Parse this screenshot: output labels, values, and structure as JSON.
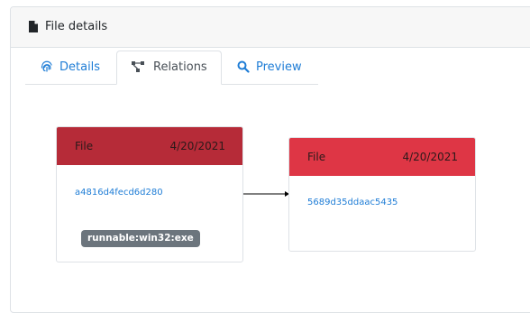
{
  "header": {
    "title": "File details",
    "icon": "file-icon"
  },
  "tabs": [
    {
      "label": "Details",
      "icon": "fingerprint-icon",
      "active": false
    },
    {
      "label": "Relations",
      "icon": "graph-icon",
      "active": true
    },
    {
      "label": "Preview",
      "icon": "search-icon",
      "active": false
    }
  ],
  "graph": {
    "nodes": [
      {
        "type": "File",
        "date": "4/20/2021",
        "hash": "a4816d4fecd6d280",
        "tag": "runnable:win32:exe",
        "header_color": "#b62b38"
      },
      {
        "type": "File",
        "date": "4/20/2021",
        "hash": "5689d35ddaac5435",
        "header_color": "#de3645"
      }
    ],
    "edge": {
      "from": 0,
      "to": 1
    }
  },
  "colors": {
    "link": "#1f7dd6",
    "tag_background": "#6c757d",
    "border": "#dee2e6"
  }
}
